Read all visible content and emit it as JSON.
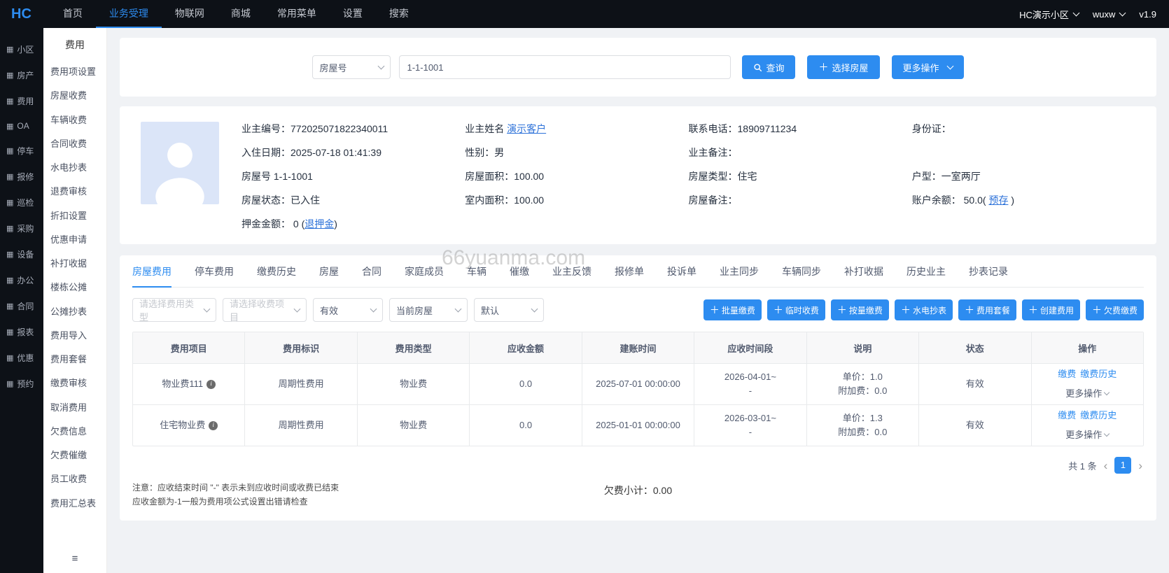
{
  "navbar": {
    "logo": "HC",
    "items": [
      {
        "label": "首页"
      },
      {
        "label": "业务受理",
        "active": true
      },
      {
        "label": "物联网"
      },
      {
        "label": "商城"
      },
      {
        "label": "常用菜单"
      },
      {
        "label": "设置"
      },
      {
        "label": "搜索"
      }
    ],
    "community": "HC演示小区",
    "user": "wuxw",
    "version": "v1.9"
  },
  "sidebar": {
    "items": [
      "小区",
      "房产",
      "费用",
      "OA",
      "停车",
      "报修",
      "巡检",
      "采购",
      "设备",
      "办公",
      "合同",
      "报表",
      "优惠",
      "预约"
    ]
  },
  "submenu": {
    "title": "费用",
    "items": [
      "费用项设置",
      "房屋收费",
      "车辆收费",
      "合同收费",
      "水电抄表",
      "退费审核",
      "折扣设置",
      "优惠申请",
      "补打收据",
      "楼栋公摊",
      "公摊抄表",
      "费用导入",
      "费用套餐",
      "缴费审核",
      "取消费用",
      "欠费信息",
      "欠费催缴",
      "员工收费",
      "费用汇总表"
    ]
  },
  "search": {
    "type_select": "房屋号",
    "input_value": "1-1-1001",
    "query_button": "查询",
    "select_house_button": "选择房屋",
    "more_button": "更多操作"
  },
  "owner": {
    "owner_no": "业主编号：772025071822340011",
    "owner_name_label": "业主姓名 ",
    "owner_name_link": "演示客户",
    "phone": "联系电话：18909711234",
    "id_card": "身份证：",
    "checkin": "入住日期：2025-07-18 01:41:39",
    "gender": "性别：男",
    "owner_remark": "业主备注：",
    "house_no": "房屋号 1-1-1001",
    "house_area": "房屋面积：100.00",
    "house_type": "房屋类型：住宅",
    "layout": "户型：一室两厅",
    "house_status": "房屋状态：已入住",
    "indoor_area": "室内面积：100.00",
    "house_remark": "房屋备注：",
    "balance_label": "账户余额： 50.0( ",
    "balance_link": "预存",
    "balance_suffix": " )",
    "deposit_label": "押金金额： 0 (",
    "deposit_link": "退押金",
    "deposit_suffix": ")"
  },
  "watermark": "66yuanma.com",
  "tabs": [
    {
      "label": "房屋费用",
      "active": true
    },
    {
      "label": "停车费用"
    },
    {
      "label": "缴费历史"
    },
    {
      "label": "房屋"
    },
    {
      "label": "合同"
    },
    {
      "label": "家庭成员"
    },
    {
      "label": "车辆"
    },
    {
      "label": "催缴"
    },
    {
      "label": "业主反馈"
    },
    {
      "label": "报修单"
    },
    {
      "label": "投诉单"
    },
    {
      "label": "业主同步"
    },
    {
      "label": "车辆同步"
    },
    {
      "label": "补打收据"
    },
    {
      "label": "历史业主"
    },
    {
      "label": "抄表记录"
    }
  ],
  "filters": [
    {
      "value": "请选择费用类型",
      "placeholder": true
    },
    {
      "value": "请选择收费项目",
      "placeholder": true
    },
    {
      "value": "有效"
    },
    {
      "value": "当前房屋"
    },
    {
      "value": "默认"
    }
  ],
  "actions": [
    "批量缴费",
    "临时收费",
    "按量缴费",
    "水电抄表",
    "费用套餐",
    "创建费用",
    "欠费缴费"
  ],
  "table": {
    "headers": [
      "费用项目",
      "费用标识",
      "费用类型",
      "应收金额",
      "建账时间",
      "应收时间段",
      "说明",
      "状态",
      "操作"
    ],
    "rows": [
      {
        "name": "物业费111",
        "flag": "周期性费用",
        "type": "物业费",
        "amount": "0.0",
        "created": "2025-07-01 00:00:00",
        "period1": "2026-04-01~",
        "period2": "-",
        "desc1": "单价：1.0",
        "desc2": "附加费：0.0",
        "status": "有效",
        "op_pay": "缴费",
        "op_history": "缴费历史",
        "op_more": "更多操作"
      },
      {
        "name": "住宅物业费",
        "flag": "周期性费用",
        "type": "物业费",
        "amount": "0.0",
        "created": "2025-01-01 00:00:00",
        "period1": "2026-03-01~",
        "period2": "-",
        "desc1": "单价：1.3",
        "desc2": "附加费：0.0",
        "status": "有效",
        "op_pay": "缴费",
        "op_history": "缴费历史",
        "op_more": "更多操作"
      }
    ]
  },
  "footer": {
    "note1": "注意：应收结束时间 \"-\" 表示未到应收时间或收费已结束",
    "note2": "应收金额为-1一般为费用项公式设置出错请检查",
    "subtotal": "欠费小计：0.00",
    "total": "共 1 条",
    "page": "1"
  }
}
